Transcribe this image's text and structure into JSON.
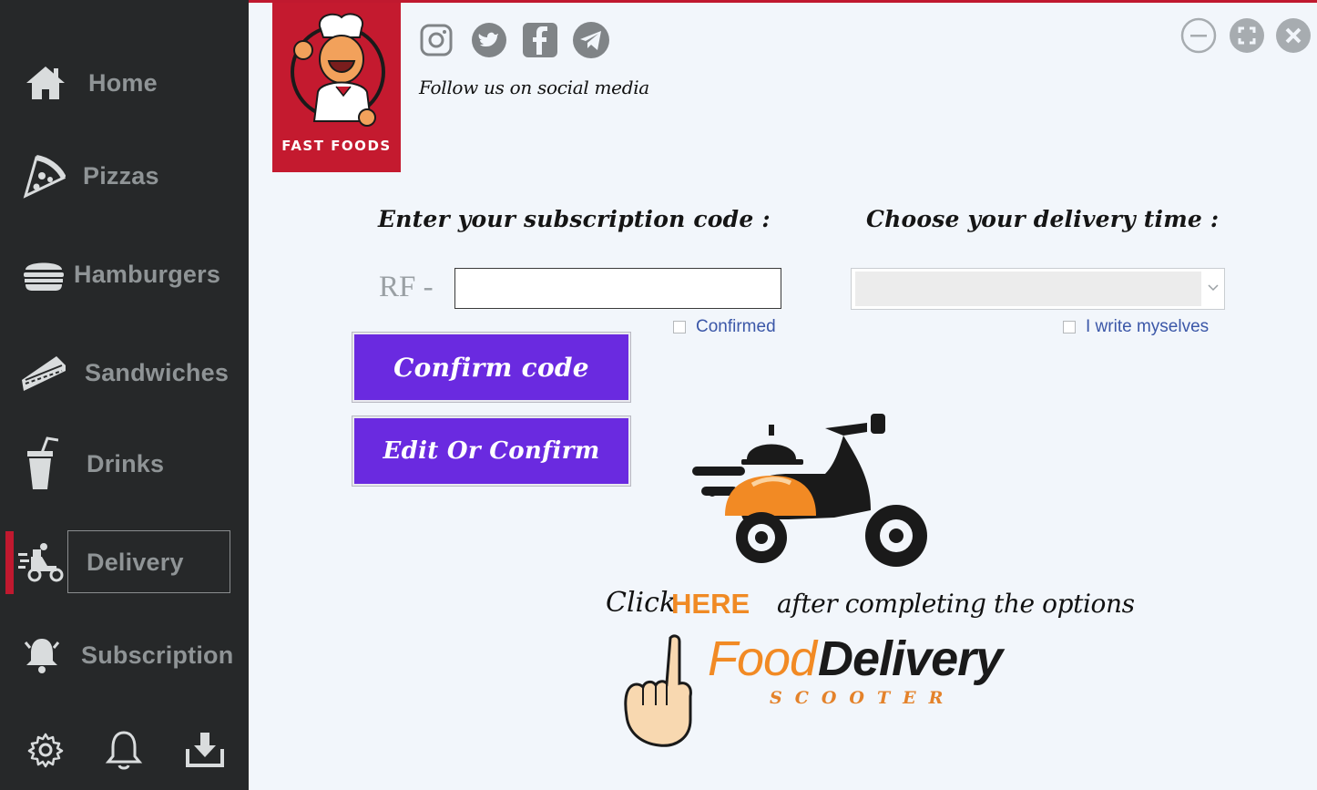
{
  "sidebar": {
    "items": [
      {
        "label": "Home",
        "icon": "home-icon"
      },
      {
        "label": "Pizzas",
        "icon": "pizza-icon"
      },
      {
        "label": "Hamburgers",
        "icon": "hamburger-icon"
      },
      {
        "label": "Sandwiches",
        "icon": "sandwich-icon"
      },
      {
        "label": "Drinks",
        "icon": "drink-icon"
      },
      {
        "label": "Delivery",
        "icon": "delivery-icon",
        "active": true
      },
      {
        "label": "Subscription",
        "icon": "bell-ring-icon"
      }
    ],
    "bottom_icons": [
      "gear-icon",
      "bell-icon",
      "download-icon"
    ]
  },
  "logo": {
    "text": "FAST FOODS",
    "color": "#c41a2f"
  },
  "social": {
    "icons": [
      "instagram-icon",
      "twitter-icon",
      "facebook-icon",
      "telegram-icon"
    ],
    "follow_text": "Follow us on social media"
  },
  "window_controls": [
    "minimize-icon",
    "maximize-icon",
    "close-icon"
  ],
  "subscription": {
    "heading": "Enter your subscription code :",
    "prefix": "RF -",
    "code_value": "",
    "confirmed_label": "Confirmed",
    "confirmed_checked": false,
    "confirm_button": "Confirm code",
    "edit_button": "Edit Or Confirm"
  },
  "delivery_time": {
    "heading": "Choose your delivery time :",
    "selected": "",
    "write_label": "I write myselves",
    "write_checked": false
  },
  "cta": {
    "click": "Click",
    "here": "HERE",
    "after": "after completing the options"
  },
  "brand": {
    "food": "Food",
    "delivery": "Delivery",
    "scooter": "SCOOTER"
  },
  "colors": {
    "accent": "#6a2ae0",
    "brand_red": "#c0192f",
    "orange": "#f28a24",
    "sidebar": "#262829"
  }
}
